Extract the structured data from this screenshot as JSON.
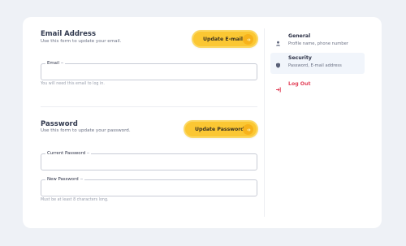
{
  "email_section": {
    "title": "Email Address",
    "subtitle": "Use this form to update your email.",
    "button_label": "Update E-mail",
    "field_label": "Email",
    "field_value": "",
    "helper": "You will need this email to log in."
  },
  "password_section": {
    "title": "Password",
    "subtitle": "Use this form to update your password.",
    "button_label": "Update Password",
    "current_label": "Current Password",
    "current_value": "",
    "new_label": "New Password",
    "new_value": "",
    "helper": "Must be at least 8 characters long."
  },
  "sidebar": {
    "items": [
      {
        "title": "General",
        "desc": "Profile name, phone number",
        "icon": "user-icon"
      },
      {
        "title": "Security",
        "desc": "Password, E-mail address",
        "icon": "shield-icon"
      }
    ],
    "logout_label": "Log Out",
    "logout_icon": "logout-icon"
  },
  "colors": {
    "accent": "#fbc733",
    "danger": "#e2435a",
    "background": "#eef1f6"
  }
}
